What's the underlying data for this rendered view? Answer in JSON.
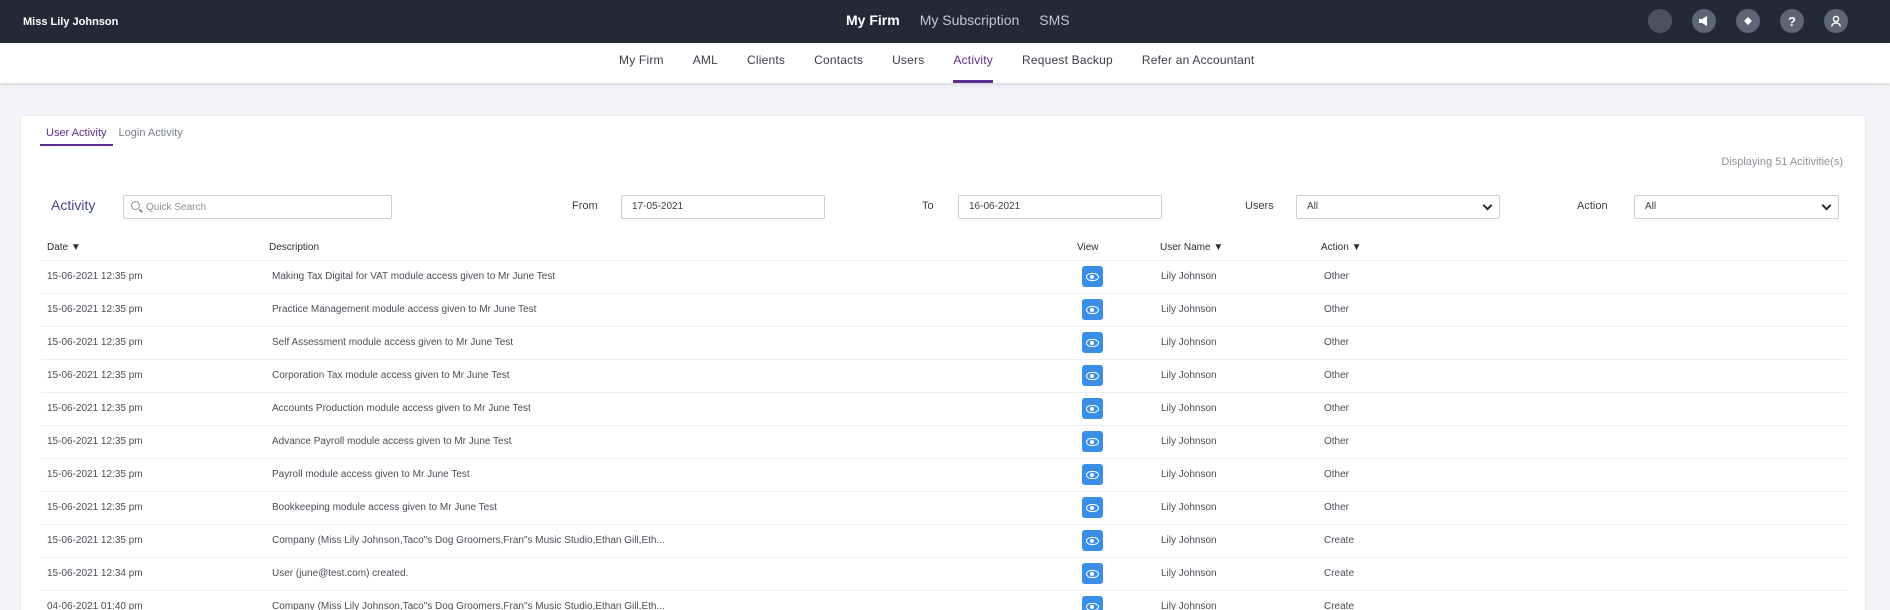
{
  "topbar": {
    "user_name": "Miss Lily Johnson",
    "nav": [
      "My Firm",
      "My Subscription",
      "SMS"
    ],
    "active_nav": "My Firm",
    "icons": [
      "status-dot-icon",
      "megaphone-icon",
      "ticket-icon",
      "help-icon",
      "profile-icon"
    ]
  },
  "subnav": {
    "items": [
      "My Firm",
      "AML",
      "Clients",
      "Contacts",
      "Users",
      "Activity",
      "Request Backup",
      "Refer an Accountant"
    ],
    "active": "Activity"
  },
  "tabs": [
    "User Activity",
    "Login Activity"
  ],
  "displaying_text": "Displaying 51 Acitivitie(s)",
  "filters": {
    "activity_label": "Activity",
    "search_placeholder": "Quick Search",
    "from_label": "From",
    "from_value": "17-05-2021",
    "to_label": "To",
    "to_value": "16-06-2021",
    "users_label": "Users",
    "users_value": "All",
    "action_label": "Action",
    "action_value": "All"
  },
  "table": {
    "headers": {
      "date": "Date ▼",
      "description": "Description",
      "view": "View",
      "user": "User Name ▼",
      "action": "Action ▼"
    },
    "rows": [
      {
        "date": "15-06-2021 12:35 pm",
        "description": "Making Tax Digital for VAT module access given to Mr June Test",
        "user": "Lily Johnson",
        "action": "Other"
      },
      {
        "date": "15-06-2021 12:35 pm",
        "description": "Practice Management module access given to Mr June Test",
        "user": "Lily Johnson",
        "action": "Other"
      },
      {
        "date": "15-06-2021 12:35 pm",
        "description": "Self Assessment module access given to Mr June Test",
        "user": "Lily Johnson",
        "action": "Other"
      },
      {
        "date": "15-06-2021 12:35 pm",
        "description": "Corporation Tax module access given to Mr June Test",
        "user": "Lily Johnson",
        "action": "Other"
      },
      {
        "date": "15-06-2021 12:35 pm",
        "description": "Accounts Production module access given to Mr June Test",
        "user": "Lily Johnson",
        "action": "Other"
      },
      {
        "date": "15-06-2021 12:35 pm",
        "description": "Advance Payroll module access given to Mr June Test",
        "user": "Lily Johnson",
        "action": "Other"
      },
      {
        "date": "15-06-2021 12:35 pm",
        "description": "Payroll module access given to Mr June Test",
        "user": "Lily Johnson",
        "action": "Other"
      },
      {
        "date": "15-06-2021 12:35 pm",
        "description": "Bookkeeping module access given to Mr June Test",
        "user": "Lily Johnson",
        "action": "Other"
      },
      {
        "date": "15-06-2021 12:35 pm",
        "description": "Company (Miss Lily Johnson,Taco\"s Dog Groomers,Fran\"s Music Studio,Ethan Gill,Eth...",
        "user": "Lily Johnson",
        "action": "Create"
      },
      {
        "date": "15-06-2021 12:34 pm",
        "description": "User (june@test.com) created.",
        "user": "Lily Johnson",
        "action": "Create"
      },
      {
        "date": "04-06-2021 01:40 pm",
        "description": "Company (Miss Lily Johnson,Taco\"s Dog Groomers,Fran\"s Music Studio,Ethan Gill,Eth...",
        "user": "Lily Johnson",
        "action": "Create"
      }
    ]
  }
}
